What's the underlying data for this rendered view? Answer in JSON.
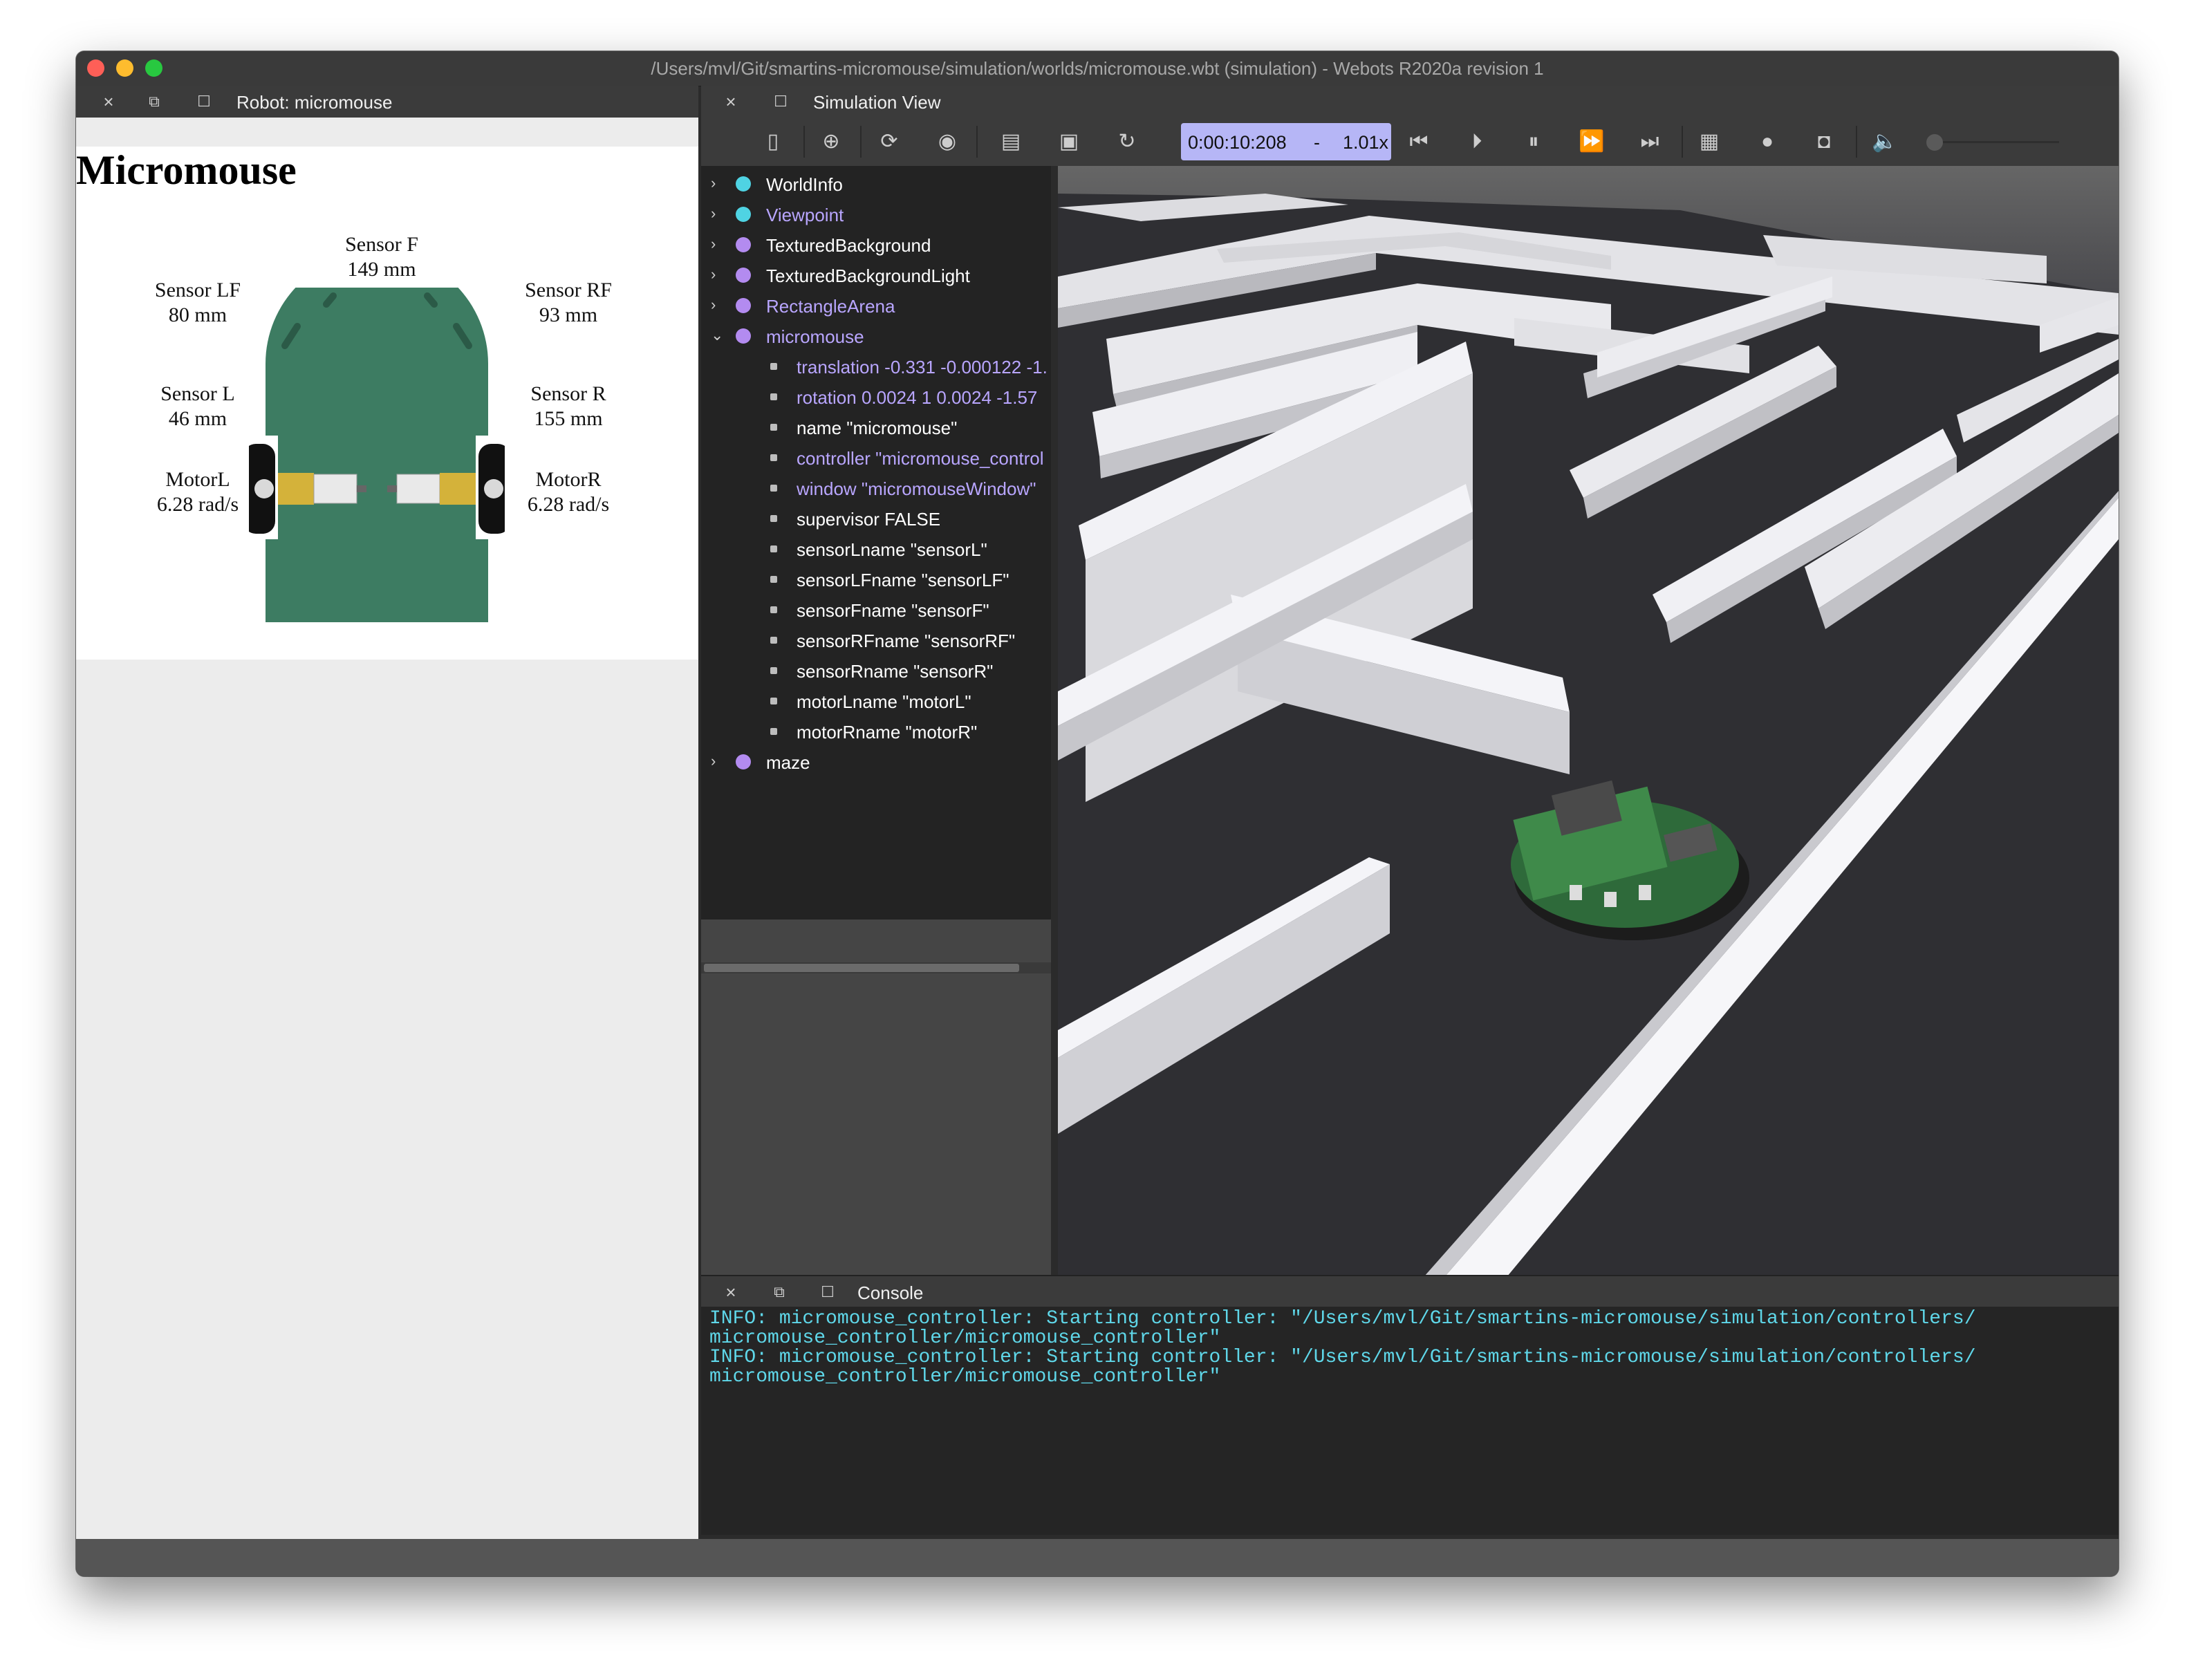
{
  "window": {
    "title": "/Users/mvl/Git/smartins-micromouse/simulation/worlds/micromouse.wbt (simulation) - Webots R2020a revision 1"
  },
  "robot_panel": {
    "tab_label": "Robot: micromouse",
    "title": "Micromouse",
    "sensor_f": {
      "label": "Sensor F",
      "value": "149 mm"
    },
    "sensor_lf": {
      "label": "Sensor LF",
      "value": "80 mm"
    },
    "sensor_rf": {
      "label": "Sensor RF",
      "value": "93 mm"
    },
    "sensor_l": {
      "label": "Sensor L",
      "value": "46 mm"
    },
    "sensor_r": {
      "label": "Sensor R",
      "value": "155 mm"
    },
    "motor_l": {
      "label": "MotorL",
      "value": "6.28 rad/s"
    },
    "motor_r": {
      "label": "MotorR",
      "value": "6.28 rad/s"
    }
  },
  "simulation_view": {
    "tab_label": "Simulation View",
    "time": "0:00:10:208",
    "time_separator": "-",
    "speed": "1.01x"
  },
  "scene_tree": {
    "nodes": [
      {
        "label": "WorldInfo",
        "color": "#4fd3e3",
        "text_color": "#ffffff",
        "expandable": true
      },
      {
        "label": "Viewpoint",
        "color": "#4fd3e3",
        "text_color": "#b9a6ff",
        "expandable": true
      },
      {
        "label": "TexturedBackground",
        "color": "#b38bf0",
        "text_color": "#ffffff",
        "expandable": true
      },
      {
        "label": "TexturedBackgroundLight",
        "color": "#b38bf0",
        "text_color": "#ffffff",
        "expandable": true
      },
      {
        "label": "RectangleArena",
        "color": "#b38bf0",
        "text_color": "#b9a6ff",
        "expandable": true
      },
      {
        "label": "micromouse",
        "color": "#b38bf0",
        "text_color": "#b9a6ff",
        "expandable": true,
        "expanded": true
      }
    ],
    "fields": [
      {
        "label": "translation -0.331 -0.000122 -1.",
        "text_color": "#b9a6ff"
      },
      {
        "label": "rotation 0.0024 1 0.0024 -1.57",
        "text_color": "#b9a6ff"
      },
      {
        "label": "name \"micromouse\"",
        "text_color": "#ffffff"
      },
      {
        "label": "controller \"micromouse_control",
        "text_color": "#b9a6ff"
      },
      {
        "label": "window \"micromouseWindow\"",
        "text_color": "#b9a6ff"
      },
      {
        "label": "supervisor FALSE",
        "text_color": "#ffffff"
      },
      {
        "label": "sensorLname \"sensorL\"",
        "text_color": "#ffffff"
      },
      {
        "label": "sensorLFname \"sensorLF\"",
        "text_color": "#ffffff"
      },
      {
        "label": "sensorFname \"sensorF\"",
        "text_color": "#ffffff"
      },
      {
        "label": "sensorRFname \"sensorRF\"",
        "text_color": "#ffffff"
      },
      {
        "label": "sensorRname \"sensorR\"",
        "text_color": "#ffffff"
      },
      {
        "label": "motorLname \"motorL\"",
        "text_color": "#ffffff"
      },
      {
        "label": "motorRname \"motorR\"",
        "text_color": "#ffffff"
      }
    ],
    "last_node": {
      "label": "maze",
      "color": "#b38bf0",
      "text_color": "#ffffff",
      "expandable": true
    }
  },
  "console": {
    "tab_label": "Console",
    "lines": [
      "INFO: micromouse_controller: Starting controller: \"/Users/mvl/Git/smartins-micromouse/simulation/controllers/",
      "micromouse_controller/micromouse_controller\"",
      "INFO: micromouse_controller: Starting controller: \"/Users/mvl/Git/smartins-micromouse/simulation/controllers/",
      "micromouse_controller/micromouse_controller\""
    ]
  },
  "icons": {
    "close": "×",
    "float": "⧉",
    "maximize": "☐"
  }
}
